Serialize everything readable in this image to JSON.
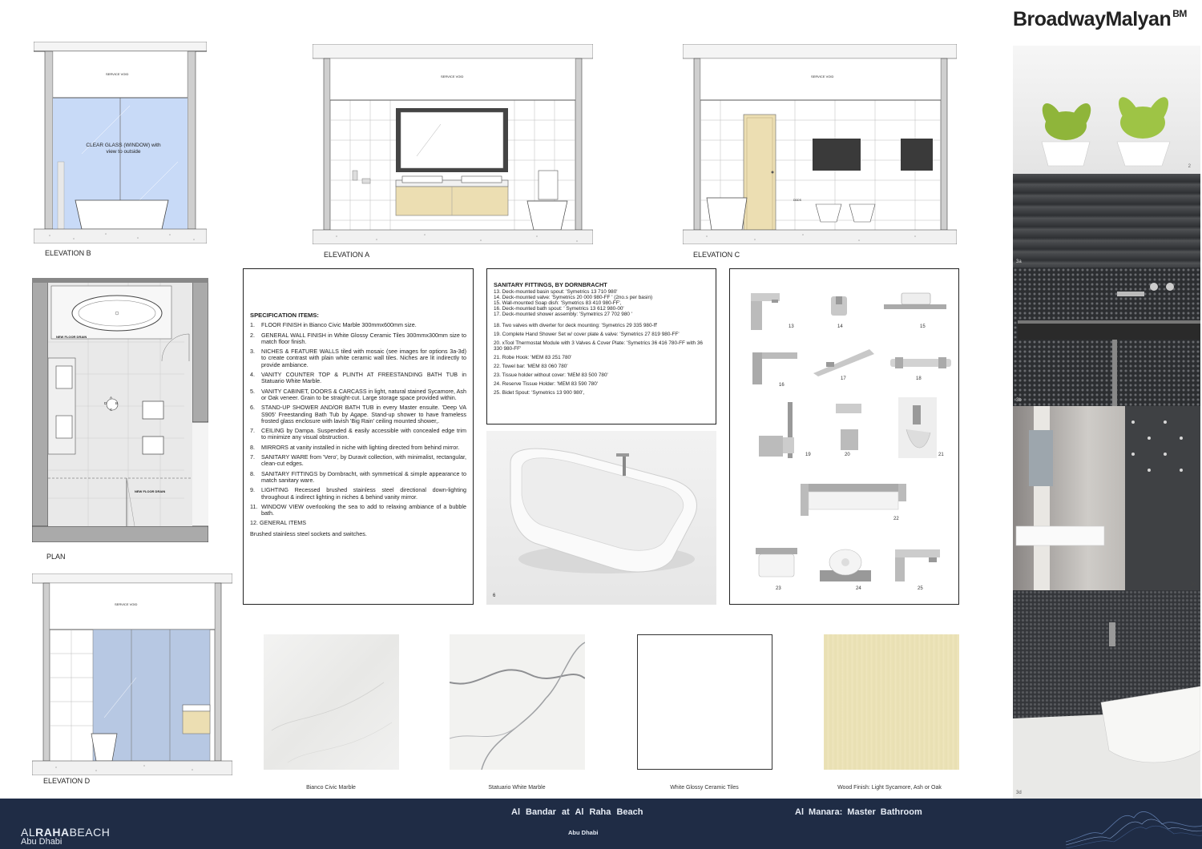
{
  "brand": {
    "name": "BroadwayMalyan",
    "mark": "BM"
  },
  "elevations": {
    "b": {
      "label": "ELEVATION B",
      "service_void": "SERVICE VOID",
      "glass_note_1": "CLEAR GLASS (WINDOW) with",
      "glass_note_2": "view to outside"
    },
    "a": {
      "label": "ELEVATION A",
      "service_void": "SERVICE VOID"
    },
    "c": {
      "label": "ELEVATION C",
      "service_void": "SERVICE VOID",
      "code": "DDDS"
    },
    "d": {
      "label": "ELEVATION D",
      "service_void": "SERVICE VOID"
    }
  },
  "plan": {
    "label": "PLAN",
    "floor_drain_1": "NEW FLOOR DRAIN",
    "floor_drain_2": "NEW FLOOR DRAIN",
    "marker": {
      "a": "A",
      "b": "B",
      "c": "C",
      "d": "D"
    }
  },
  "spec": {
    "title": "SPECIFICATION ITEMS:",
    "items": [
      {
        "n": "1.",
        "t": "FLOOR FINISH in Bianco Civic Marble 300mmx600mm size."
      },
      {
        "n": "2.",
        "t": "GENERAL WALL FINISH in White Glossy Ceramic Tiles 300mmx300mm size to match floor finish."
      },
      {
        "n": "3.",
        "t": "NICHES & FEATURE WALLS tiled with mosaic (see images for options 3a-3d) to create contrast with plain white ceramic wall tiles. Niches are lit indirectly to provide ambiance."
      },
      {
        "n": "4.",
        "t": "VANITY COUNTER TOP & PLINTH AT FREESTANDING BATH TUB in Statuario White Marble."
      },
      {
        "n": "5.",
        "t": "VANITY CABINET, DOORS & CARCASS in light, natural stained Sycamore, Ash or Oak veneer. Grain to be straight-cut. Large storage space provided within."
      },
      {
        "n": "6.",
        "t": "STAND-UP SHOWER AND/OR BATH TUB in every Master ensuite. 'Deep VA S905' Freestanding Bath Tub by Agape. Stand-up shower to have frameless frosted glass enclosure with lavish 'Big Rain' ceiling mounted shower,."
      },
      {
        "n": "7.",
        "t": "CEILING by Dampa. Suspended & easily accessible with concealed edge trim to minimize any visual obstruction."
      },
      {
        "n": "8.",
        "t": "MIRRORS at vanity installed in niche with lighting directed from behind mirror."
      },
      {
        "n": "7.",
        "t": "SANITARY WARE from 'Vero', by Duravit collection, with minimalist, rectangular, clean-cut edges."
      },
      {
        "n": "8.",
        "t": "SANITARY FITTINGS by Dornbracht, with symmetrical & simple appearance to match sanitary ware."
      },
      {
        "n": "9.",
        "t": "LIGHTING Recessed brushed stainless steel directional down-lighting throughout & indirect lighting in niches & behind vanity mirror."
      },
      {
        "n": "11.",
        "t": "WINDOW VIEW overlooking the sea to add to relaxing ambiance of a bubble bath."
      }
    ],
    "general_title": "12. GENERAL ITEMS",
    "general_text": "Brushed stainless steel sockets and switches."
  },
  "fittings": {
    "title": "SANITARY FITTINGS, BY DORNBRACHT",
    "group1": [
      "13. Deck-mounted basin spout: 'Symetrics 13 710 980'",
      "14. Deck-mounted valve: 'Symetrics 20 000 980-FF ' (2no.s per basin)",
      "15. Wall-mounted Soap dish: 'Symetrics 83 410 980-FF',",
      "16. Deck-mounted bath spout: ' Symetrics 13 612 980-00'",
      "17. Deck-mounted shower assembly: 'Symetrics 27 702 980 '"
    ],
    "group2": [
      "18. Two valves with diverter for deck mounting: 'Symetrics 29 335 980-ff'",
      "19. Complete Hand Shower Set w/ cover plate & valve: 'Symetrics 27 819 980-FF'",
      "20. xTool Thermostat Module with 3 Valves & Cover Plate: 'Symetrics 36 416 780-FF with 36 330 980-FF'",
      "21. Robe Hook: 'MEM 83 251 780'",
      "22. Towel bar: 'MEM 83 060 780'",
      "23. Tissue holder without cover: 'MEM 83 500 780'",
      "24. Reserve Tissue Holder: 'MEM 83 590 780'",
      "25. Bidet Spout: 'Symetrics 13 900 980',"
    ]
  },
  "bathtub_photo": {
    "number": "6"
  },
  "fitting_numbers": [
    "13",
    "14",
    "15",
    "16",
    "17",
    "18",
    "19",
    "20",
    "21",
    "22",
    "23",
    "24",
    "25"
  ],
  "materials": [
    {
      "name": "Bianco Civic Marble",
      "color": "#efeeec"
    },
    {
      "name": "Statuario White Marble",
      "color": "#f3f3f1"
    },
    {
      "name": "White Glossy Ceramic Tiles",
      "color": "#ffffff"
    },
    {
      "name": "Wood Finish: Light Sycamore, Ash or Oak",
      "color": "#ece3b8"
    }
  ],
  "mood_photos": [
    {
      "number": "2"
    },
    {
      "number": "3a"
    },
    {
      "number": "3b"
    },
    {
      "number": "3c"
    },
    {
      "number": "3d"
    }
  ],
  "footer": {
    "logo_part1": "AL",
    "logo_part2": "RAHA",
    "logo_part3": "BEACH",
    "logo_sub": "Abu Dhabi",
    "project": "Al Bandar at Al Raha Beach",
    "location": "Abu Dhabi",
    "sheet": "Al Manara: Master Bathroom"
  },
  "colors": {
    "footer_bg": "#1f2c45",
    "glass": "#c8daf7",
    "wood": "#ecdeb2",
    "mosaic_blue": "#b7c8e3"
  }
}
